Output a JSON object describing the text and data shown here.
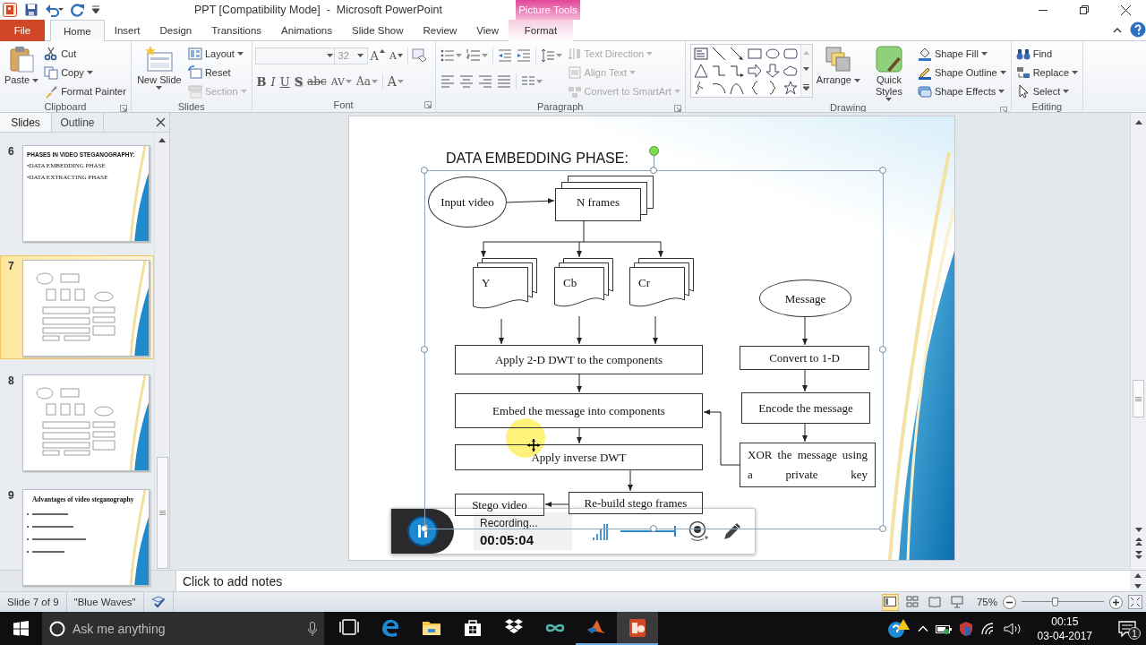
{
  "window": {
    "title": "PPT [Compatibility Mode]  -  Microsoft PowerPoint",
    "context_group": "Picture Tools"
  },
  "tabs": [
    {
      "label": "File",
      "kind": "backstage",
      "selected": false
    },
    {
      "label": "Home",
      "kind": "normal",
      "selected": true
    },
    {
      "label": "Insert",
      "kind": "normal",
      "selected": false
    },
    {
      "label": "Design",
      "kind": "normal",
      "selected": false
    },
    {
      "label": "Transitions",
      "kind": "normal",
      "selected": false
    },
    {
      "label": "Animations",
      "kind": "normal",
      "selected": false
    },
    {
      "label": "Slide Show",
      "kind": "normal",
      "selected": false
    },
    {
      "label": "Review",
      "kind": "normal",
      "selected": false
    },
    {
      "label": "View",
      "kind": "normal",
      "selected": false
    },
    {
      "label": "Format",
      "kind": "contextual",
      "selected": false
    }
  ],
  "ribbon": {
    "groups": [
      {
        "kind": "buttons",
        "label": "Clipboard",
        "launcher": true,
        "large": [
          {
            "label": "Paste",
            "kind": "paste",
            "dropdown": true,
            "disabled": false
          }
        ],
        "small": [
          {
            "label": "Cut",
            "kind": "cut",
            "dropdown": false,
            "disabled": false
          },
          {
            "label": "Copy",
            "kind": "copy",
            "dropdown": true,
            "disabled": false
          },
          {
            "label": "Format Painter",
            "kind": "brush",
            "dropdown": false,
            "disabled": false
          }
        ]
      },
      {
        "kind": "buttons",
        "label": "Slides",
        "launcher": false,
        "large": [
          {
            "label": "New Slide",
            "kind": "newslide",
            "dropdown": true,
            "disabled": false
          }
        ],
        "small": [
          {
            "label": "Layout",
            "kind": "layout",
            "dropdown": true,
            "disabled": false
          },
          {
            "label": "Reset",
            "kind": "reset",
            "dropdown": false,
            "disabled": false
          },
          {
            "label": "Section",
            "kind": "section",
            "dropdown": true,
            "disabled": true
          }
        ]
      },
      {
        "kind": "font",
        "label": "Font",
        "launcher": true,
        "font_size": "32",
        "size_buttons": [
          {
            "glyph": "A",
            "kind": "grow"
          },
          {
            "glyph": "A",
            "kind": "shrink"
          }
        ],
        "format_buttons": [
          {
            "glyph": "B",
            "kind": "bold",
            "dropdown": false
          },
          {
            "glyph": "I",
            "kind": "italic",
            "dropdown": false
          },
          {
            "glyph": "U",
            "kind": "underline",
            "dropdown": false
          },
          {
            "glyph": "S",
            "kind": "shadow",
            "dropdown": false
          },
          {
            "glyph": "abc",
            "kind": "strike",
            "dropdown": false
          },
          {
            "glyph": "AV",
            "kind": "spacing",
            "dropdown": true
          },
          {
            "glyph": "Aa",
            "kind": "case",
            "dropdown": true
          },
          {
            "glyph": "A",
            "kind": "color",
            "dropdown": true
          }
        ]
      },
      {
        "kind": "paragraph",
        "label": "Paragraph",
        "launcher": true,
        "small": [
          {
            "label": "Text Direction",
            "kind": "textdir",
            "dropdown": true,
            "disabled": true
          },
          {
            "label": "Align Text",
            "kind": "aligntext",
            "dropdown": true,
            "disabled": true
          },
          {
            "label": "Convert to SmartArt",
            "kind": "smartart",
            "dropdown": true,
            "disabled": true
          }
        ]
      },
      {
        "kind": "drawing",
        "label": "Drawing",
        "launcher": true,
        "large": [
          {
            "label": "Arrange",
            "kind": "arrange",
            "dropdown": true,
            "disabled": false
          },
          {
            "label": "Quick Styles",
            "kind": "quickstyles",
            "dropdown": true,
            "disabled": false
          }
        ],
        "small": [
          {
            "label": "Shape Fill",
            "kind": "fill",
            "dropdown": true,
            "disabled": false
          },
          {
            "label": "Shape Outline",
            "kind": "outline",
            "dropdown": true,
            "disabled": false
          },
          {
            "label": "Shape Effects",
            "kind": "effects",
            "dropdown": true,
            "disabled": false
          }
        ]
      },
      {
        "kind": "buttons",
        "label": "Editing",
        "launcher": false,
        "small": [
          {
            "label": "Find",
            "kind": "find",
            "dropdown": false,
            "disabled": false
          },
          {
            "label": "Replace",
            "kind": "replace",
            "dropdown": true,
            "disabled": false
          },
          {
            "label": "Select",
            "kind": "select",
            "dropdown": true,
            "disabled": false
          }
        ]
      }
    ]
  },
  "slides_pane": {
    "tabs": [
      {
        "label": "Slides",
        "selected": true
      },
      {
        "label": "Outline",
        "selected": false
      }
    ],
    "thumbnails": [
      {
        "number": "6",
        "kind": "text",
        "selected": false,
        "lines": [
          "PHASES IN VIDEO STEGANOGRAPHY:",
          "•DATA  EMBEDDING PHASE",
          "•DATA  EXTRACTING PHASE"
        ]
      },
      {
        "number": "7",
        "kind": "flowchart",
        "selected": true
      },
      {
        "number": "8",
        "kind": "flowchart",
        "selected": false
      },
      {
        "number": "9",
        "kind": "bullets",
        "selected": false,
        "lines": [
          "Advantages of video steganography"
        ]
      }
    ]
  },
  "slide": {
    "title": "DATA EMBEDDING PHASE:",
    "diagram_selected": true,
    "nodes": [
      {
        "kind": "ellipse",
        "text": "Input video"
      },
      {
        "kind": "stack",
        "text": "N frames"
      },
      {
        "kind": "document",
        "text": "Y"
      },
      {
        "kind": "document",
        "text": "Cb"
      },
      {
        "kind": "document",
        "text": "Cr"
      },
      {
        "kind": "ellipse",
        "text": "Message"
      },
      {
        "kind": "rect",
        "text": "Apply 2-D DWT to the components"
      },
      {
        "kind": "rect",
        "text": "Convert to 1-D"
      },
      {
        "kind": "rect",
        "text": "Embed the message into components"
      },
      {
        "kind": "rect",
        "text": "Encode the message"
      },
      {
        "kind": "rect",
        "text": "Apply inverse DWT"
      },
      {
        "kind": "rect",
        "text": "XOR the message using a private key"
      },
      {
        "kind": "rect",
        "text": "Stego video"
      },
      {
        "kind": "rect",
        "text": "Re-build stego frames"
      }
    ]
  },
  "notes": {
    "placeholder": "Click to add notes"
  },
  "recorder": {
    "status": "Recording...",
    "time": "00:05:04",
    "volume": {
      "level": 1
    }
  },
  "status_bar": {
    "slide_info": "Slide 7 of 9",
    "theme": "\"Blue Waves\"",
    "views": [
      {
        "kind": "normal",
        "selected": true
      },
      {
        "kind": "sorter",
        "selected": false
      },
      {
        "kind": "reading",
        "selected": false
      },
      {
        "kind": "slideshow",
        "selected": false
      }
    ],
    "zoom": "75%",
    "zoom_slider": {
      "level": 0.4
    }
  },
  "taskbar": {
    "search": {
      "placeholder": "Ask me anything"
    },
    "apps": [
      {
        "kind": "taskview",
        "running": false,
        "selected": false
      },
      {
        "kind": "edge",
        "running": false,
        "selected": false
      },
      {
        "kind": "explorer",
        "running": false,
        "selected": false
      },
      {
        "kind": "store",
        "running": false,
        "selected": false
      },
      {
        "kind": "dropbox",
        "running": false,
        "selected": false
      },
      {
        "kind": "infinity",
        "running": false,
        "selected": false
      },
      {
        "kind": "matlab",
        "running": true,
        "selected": false
      },
      {
        "kind": "powerpoint",
        "running": true,
        "selected": true
      }
    ],
    "time": "00:15",
    "date": "03-04-2017",
    "notification_count": "1"
  }
}
